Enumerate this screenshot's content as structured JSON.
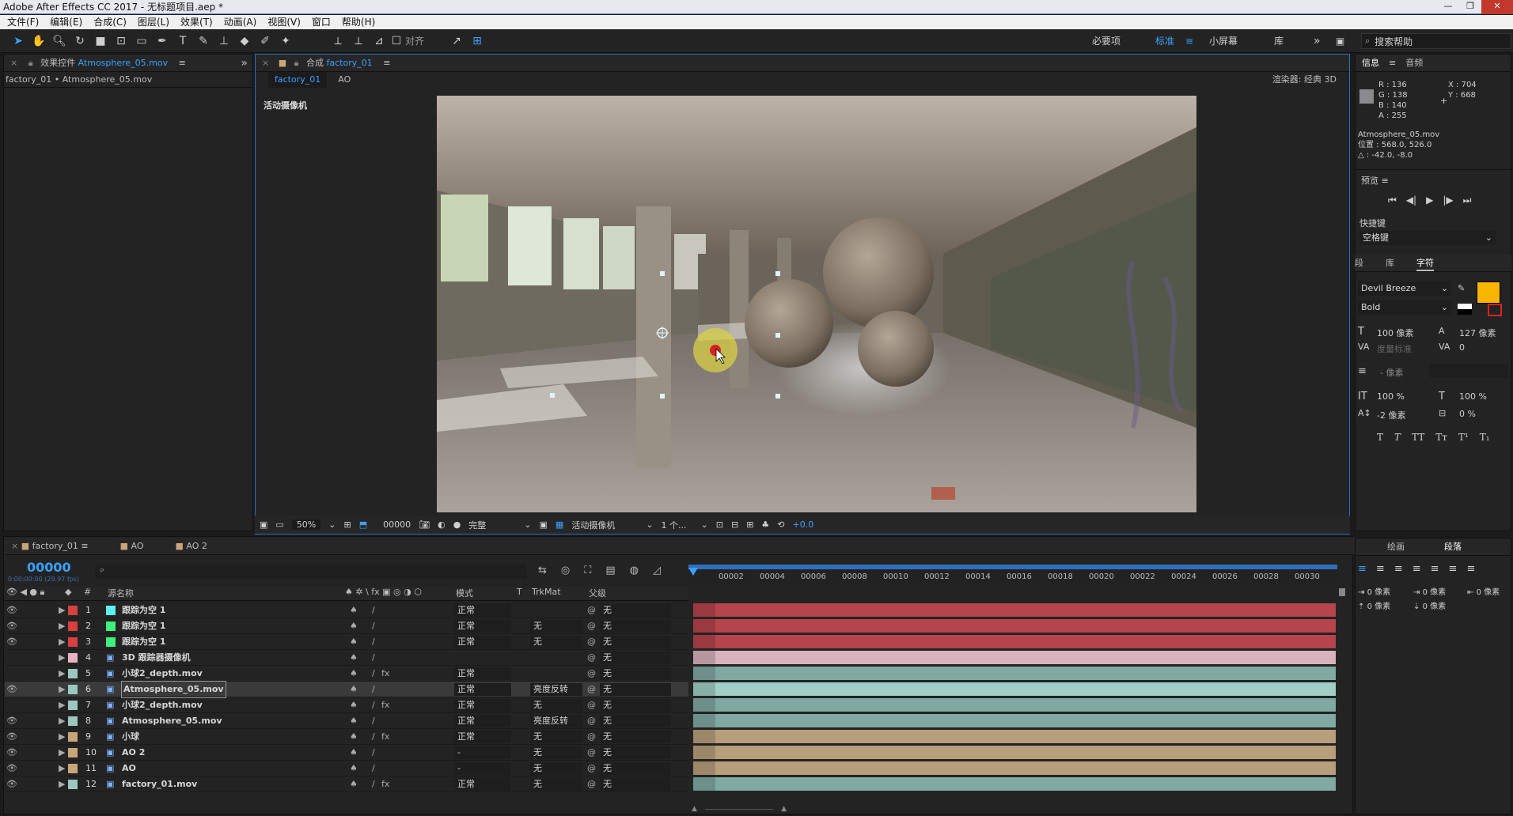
{
  "app": {
    "title": "Adobe After Effects CC 2017 - 无标题项目.aep *"
  },
  "window_buttons": [
    "—",
    "❐",
    "✕"
  ],
  "menu": [
    "文件(F)",
    "编辑(E)",
    "合成(C)",
    "图层(L)",
    "效果(T)",
    "动画(A)",
    "视图(V)",
    "窗口",
    "帮助(H)"
  ],
  "toolbar": {
    "snap_label": "对齐",
    "workspaces": [
      "必要项",
      "标准",
      "小屏幕",
      "库"
    ],
    "active_workspace": "标准",
    "search_placeholder": "搜索帮助"
  },
  "effects_panel": {
    "tab_label": "效果控件",
    "tab_file": "Atmosphere_05.mov",
    "breadcrumb": "factory_01 • Atmosphere_05.mov"
  },
  "comp_panel": {
    "tab_prefix": "合成",
    "tab_name": "factory_01",
    "sub_tabs": [
      "factory_01",
      "AO"
    ],
    "renderer_label": "渲染器:",
    "renderer_value": "经典 3D",
    "camera_label": "活动摄像机"
  },
  "viewer_controls": {
    "zoom": "50%",
    "timecode": "00000",
    "resolution": "完整",
    "view": "活动摄像机",
    "views_count": "1 个...",
    "exposure": "+0.0"
  },
  "info_panel": {
    "tabs": [
      "信息",
      "音频"
    ],
    "r": "R : 136",
    "g": "G : 138",
    "b": "B : 140",
    "a": "A : 255",
    "x": "X : 704",
    "y": "Y : 668",
    "layer": "Atmosphere_05.mov",
    "position": "位置 : 568.0, 526.0",
    "delta": "△ : -42.0, -8.0",
    "swatch_color": "#888a8c"
  },
  "preview_panel": {
    "title": "预览",
    "shortcut_label": "快捷键",
    "shortcut_value": "空格键"
  },
  "character_panel": {
    "tabs": [
      "段",
      "库",
      "字符"
    ],
    "font": "Devil Breeze",
    "style": "Bold",
    "size": "100 像素",
    "leading": "127 像素",
    "kerning": "度量标准",
    "tracking": "0",
    "stroke": "- 像素",
    "vscale": "100 %",
    "hscale": "100 %",
    "baseline": "-2 像素",
    "tsume": "0 %",
    "fill_color": "#f7b500",
    "styles": [
      "T",
      "T",
      "TT",
      "Tт",
      "T¹",
      "T₁"
    ]
  },
  "paragraph_panel": {
    "tabs": [
      "绘画",
      "段落"
    ],
    "indent_left": "0 像素",
    "indent_first": "0 像素",
    "indent_right": "0 像素",
    "space_before": "0 像素",
    "space_after": "0 像素"
  },
  "timeline": {
    "tabs": [
      "factory_01",
      "AO",
      "AO 2"
    ],
    "timecode": "00000",
    "fps": "0:00:00:00 (29.97 fps)",
    "col_source": "源名称",
    "col_mode": "模式",
    "col_t": "T",
    "col_trkmat": "TrkMat",
    "col_parent": "父级",
    "col_num": "#",
    "ruler": [
      "00002",
      "00004",
      "00006",
      "00008",
      "00010",
      "00012",
      "00014",
      "00016",
      "00018",
      "00020",
      "00022",
      "00024",
      "00026",
      "00028",
      "00030"
    ],
    "layers": [
      {
        "num": "1",
        "name": "跟踪为空 1",
        "label": "#d94040",
        "icon_color": "#5ff0f0",
        "mode": "正常",
        "trkmat": "",
        "parent": "无",
        "bar": "#b5444c",
        "fx": false,
        "eye": true
      },
      {
        "num": "2",
        "name": "跟踪为空 1",
        "label": "#d94040",
        "icon_color": "#3ff07a",
        "mode": "正常",
        "trkmat": "无",
        "parent": "无",
        "bar": "#b5444c",
        "fx": false,
        "eye": true
      },
      {
        "num": "3",
        "name": "跟踪为空 1",
        "label": "#d94040",
        "icon_color": "#3ff07a",
        "mode": "正常",
        "trkmat": "无",
        "parent": "无",
        "bar": "#b5444c",
        "fx": false,
        "eye": true
      },
      {
        "num": "4",
        "name": "3D 跟踪器摄像机",
        "label": "#e6b3c0",
        "icon_color": "",
        "mode": "",
        "trkmat": "",
        "parent": "无",
        "bar": "#d9b3bc",
        "fx": false,
        "eye": false
      },
      {
        "num": "5",
        "name": "小球2_depth.mov",
        "label": "#9bc7c0",
        "icon_color": "",
        "mode": "正常",
        "trkmat": "",
        "parent": "无",
        "bar": "#7fa9a1",
        "fx": true,
        "eye": false
      },
      {
        "num": "6",
        "name": "Atmosphere_05.mov",
        "label": "#9bc7c0",
        "icon_color": "",
        "mode": "正常",
        "trkmat": "亮度反转",
        "parent": "无",
        "bar": "#9fcfc5",
        "fx": false,
        "eye": true,
        "selected": true
      },
      {
        "num": "7",
        "name": "小球2_depth.mov",
        "label": "#9bc7c0",
        "icon_color": "",
        "mode": "正常",
        "trkmat": "无",
        "parent": "无",
        "bar": "#7fa9a1",
        "fx": true,
        "eye": false
      },
      {
        "num": "8",
        "name": "Atmosphere_05.mov",
        "label": "#9bc7c0",
        "icon_color": "",
        "mode": "正常",
        "trkmat": "亮度反转",
        "parent": "无",
        "bar": "#7fa9a1",
        "fx": false,
        "eye": true
      },
      {
        "num": "9",
        "name": "小球",
        "label": "#c9a67a",
        "icon_color": "",
        "mode": "正常",
        "trkmat": "无",
        "parent": "无",
        "bar": "#b89f7c",
        "fx": true,
        "eye": true
      },
      {
        "num": "10",
        "name": "AO 2",
        "label": "#c9a67a",
        "icon_color": "",
        "mode": "-",
        "trkmat": "无",
        "parent": "无",
        "bar": "#b89f7c",
        "fx": false,
        "eye": true
      },
      {
        "num": "11",
        "name": "AO",
        "label": "#c9a67a",
        "icon_color": "",
        "mode": "-",
        "trkmat": "无",
        "parent": "无",
        "bar": "#b89f7c",
        "fx": false,
        "eye": true
      },
      {
        "num": "12",
        "name": "factory_01.mov",
        "label": "#9bc7c0",
        "icon_color": "",
        "mode": "正常",
        "trkmat": "无",
        "parent": "无",
        "bar": "#7fa9a1",
        "fx": true,
        "eye": true
      }
    ]
  }
}
